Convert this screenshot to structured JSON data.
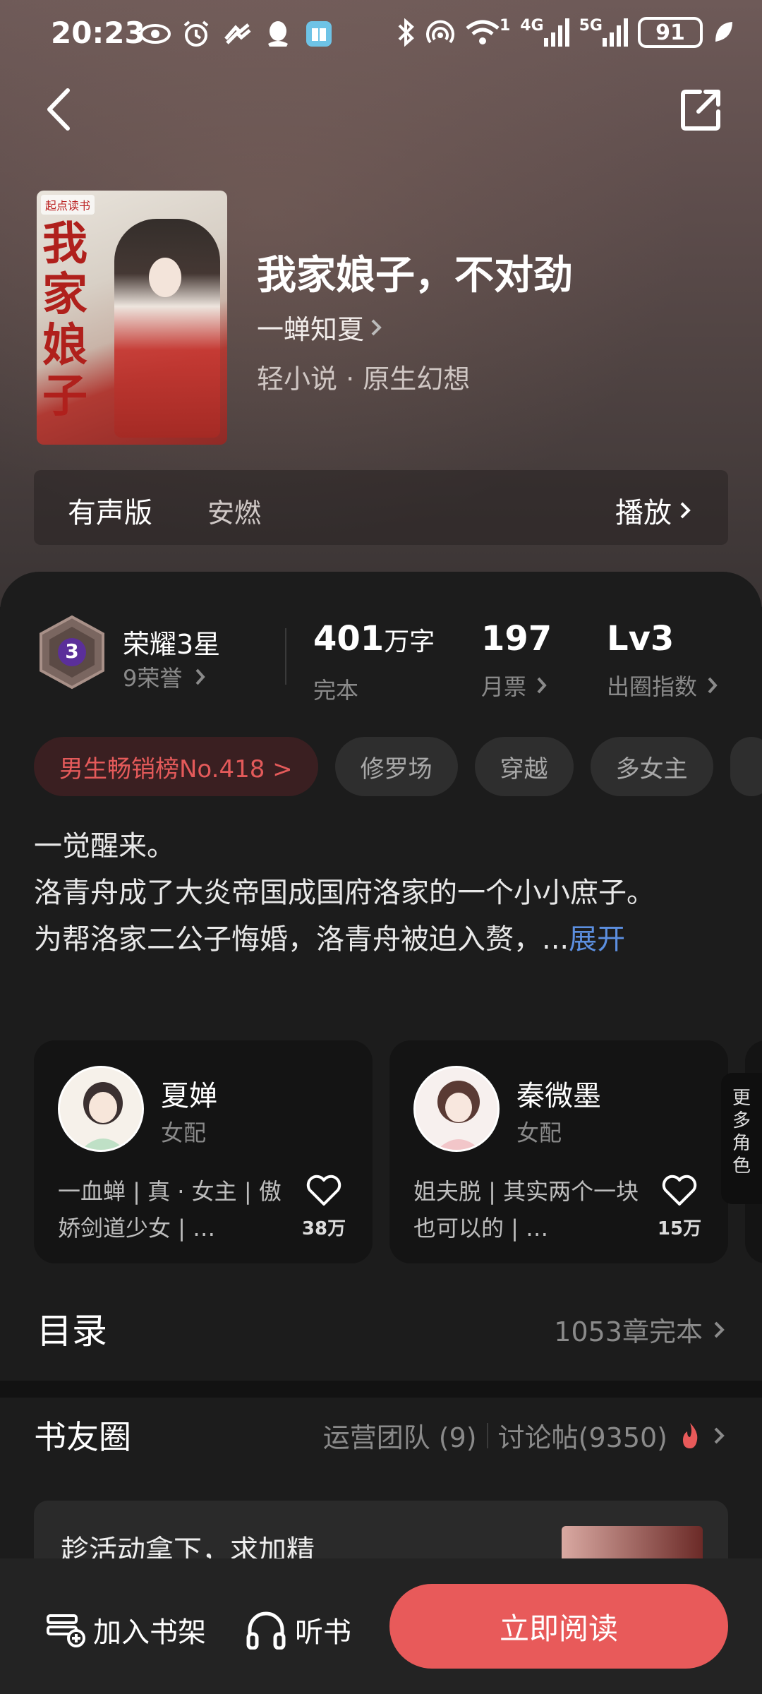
{
  "status_bar": {
    "time": "20:23",
    "net1": "4G",
    "net2": "5G",
    "wifi_sup": "1",
    "battery": "91"
  },
  "book": {
    "cover_brand": "起点读书",
    "cover_title": "我家娘子",
    "title": "我家娘子，不对劲",
    "author": "一蝉知夏",
    "genre": "轻小说 · 原生幻想"
  },
  "audio": {
    "label": "有声版",
    "narrator": "安燃",
    "play_label": "播放"
  },
  "stats": {
    "honor_title": "荣耀3星",
    "honor_sub": "9荣誉",
    "badge_level": "3",
    "words": "401",
    "words_unit": "万字",
    "words_label": "完本",
    "tickets": "197",
    "tickets_label": "月票",
    "level": "Lv3",
    "level_label": "出圈指数"
  },
  "tags": [
    "男生畅销榜No.418 >",
    "修罗场",
    "穿越",
    "多女主"
  ],
  "synopsis": {
    "line1": "一觉醒来。",
    "line2": "洛青舟成了大炎帝国成国府洛家的一个小小庶子。",
    "line3": "为帮洛家二公子悔婚，洛青舟被迫入赘，...",
    "expand": "展开"
  },
  "characters": [
    {
      "name": "夏婵",
      "role": "女配",
      "desc": "一血蝉 | 真 · 女主 | 傲娇剑道少女 | …",
      "likes": "38万"
    },
    {
      "name": "秦微墨",
      "role": "女配",
      "desc": "姐夫脱 | 其实两个一块也可以的 | …",
      "likes": "15万"
    }
  ],
  "more_roles": "更多角色",
  "toc": {
    "title": "目录",
    "info": "1053章完本"
  },
  "circle": {
    "title": "书友圈",
    "team": "运营团队 (9)",
    "posts": "讨论帖(9350)",
    "post_text": "趁活动拿下，求加精"
  },
  "bottom": {
    "shelf": "加入书架",
    "listen": "听书",
    "read": "立即阅读"
  },
  "colors": {
    "accent": "#e85a5a",
    "link": "#5c8fe0",
    "panel": "#1c1c1c"
  }
}
